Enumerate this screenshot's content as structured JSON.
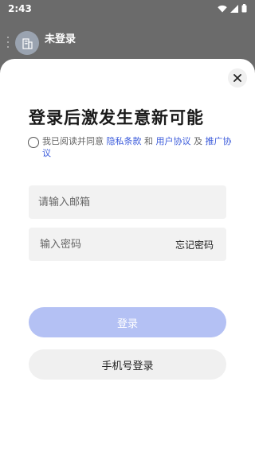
{
  "status_bar": {
    "time": "2:43"
  },
  "background": {
    "user_name": "未登录"
  },
  "sheet": {
    "title": "登录后激发生意新可能",
    "agreement": {
      "prefix": "我已阅读并同意 ",
      "privacy": "隐私条款",
      "and": " 和 ",
      "user_agreement": "用户协议",
      "and2": " 及 ",
      "promotion": "推广协议"
    },
    "email": {
      "placeholder": "请输入邮箱",
      "value": ""
    },
    "password": {
      "placeholder": "输入密码",
      "value": ""
    },
    "forgot_label": "忘记密码",
    "login_label": "登录",
    "phone_login_label": "手机号登录"
  },
  "colors": {
    "link": "#3b5bdb",
    "login_button": "#b4c1f4"
  }
}
